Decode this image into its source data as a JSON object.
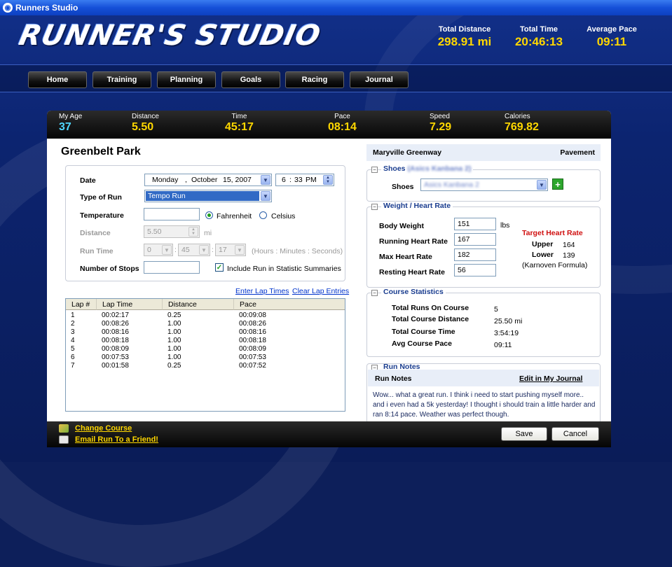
{
  "window": {
    "title": "Runners Studio"
  },
  "logo": "RUNNER'S STUDIO",
  "header_stats": [
    {
      "label": "Total Distance",
      "value": "298.91 mi"
    },
    {
      "label": "Total Time",
      "value": "20:46:13"
    },
    {
      "label": "Average Pace",
      "value": "09:11"
    }
  ],
  "nav": [
    "Home",
    "Training",
    "Planning",
    "Goals",
    "Racing",
    "Journal"
  ],
  "stats": [
    {
      "label": "My Age",
      "value": "37"
    },
    {
      "label": "Distance",
      "value": "5.50"
    },
    {
      "label": "Time",
      "value": "45:17"
    },
    {
      "label": "Pace",
      "value": "08:14"
    },
    {
      "label": "Speed",
      "value": "7.29"
    },
    {
      "label": "Calories",
      "value": "769.82"
    }
  ],
  "run": {
    "location": "Greenbelt Park",
    "date_label": "Date",
    "date_weekday": "Monday",
    "date_sep": ",",
    "date_month": "October",
    "date_day": "15, 2007",
    "time_hour": "6",
    "time_sep": ":",
    "time_min": "33",
    "time_ampm": "PM",
    "type_label": "Type of Run",
    "type_value": "Tempo Run",
    "temp_label": "Temperature",
    "temp_value": "",
    "fahrenheit": "Fahrenheit",
    "celsius": "Celsius",
    "distance_label": "Distance",
    "distance_value": "5.50",
    "distance_unit": "mi",
    "runtime_label": "Run Time",
    "rt_hours": "0",
    "rt_minutes": "45",
    "rt_seconds": "17",
    "rt_colon": ":",
    "rt_hint": "(Hours : Minutes : Seconds)",
    "stops_label": "Number of Stops",
    "stops_value": "",
    "include_label": "Include Run in Statistic Summaries",
    "include_check": "✓"
  },
  "laps": {
    "enter_link": "Enter Lap Times",
    "clear_link": "Clear Lap Entries",
    "headers": [
      "Lap #",
      "Lap Time",
      "Distance",
      "Pace"
    ],
    "rows": [
      [
        "1",
        "00:02:17",
        "0.25",
        "00:09:08"
      ],
      [
        "2",
        "00:08:26",
        "1.00",
        "00:08:26"
      ],
      [
        "3",
        "00:08:16",
        "1.00",
        "00:08:16"
      ],
      [
        "4",
        "00:08:18",
        "1.00",
        "00:08:18"
      ],
      [
        "5",
        "00:08:09",
        "1.00",
        "00:08:09"
      ],
      [
        "6",
        "00:07:53",
        "1.00",
        "00:07:53"
      ],
      [
        "7",
        "00:01:58",
        "0.25",
        "00:07:52"
      ]
    ]
  },
  "course": {
    "name": "Maryville Greenway",
    "surface": "Pavement"
  },
  "shoes": {
    "title": "Shoes",
    "title_detail": "(Asics Kanbana 2)",
    "label": "Shoes",
    "value": "Asics Kanbana 2",
    "add": "+"
  },
  "weight": {
    "title": "Weight / Heart Rate",
    "body_label": "Body Weight",
    "body_value": "151",
    "body_unit": "lbs",
    "running_label": "Running Heart Rate",
    "running_value": "167",
    "max_label": "Max Heart Rate",
    "max_value": "182",
    "resting_label": "Resting Heart Rate",
    "resting_value": "56",
    "target_title": "Target Heart Rate",
    "upper_label": "Upper",
    "upper_value": "164",
    "lower_label": "Lower",
    "lower_value": "139",
    "formula": "(Karnoven Formula)"
  },
  "course_stats": {
    "title": "Course Statistics",
    "rows": [
      {
        "label": "Total Runs On Course",
        "value": "5"
      },
      {
        "label": "Total Course Distance",
        "value": "25.50 mi"
      },
      {
        "label": "Total Course Time",
        "value": "3:54:19"
      },
      {
        "label": "Avg Course Pace",
        "value": "09:11"
      }
    ]
  },
  "notes": {
    "title": "Run Notes",
    "header": "Run Notes",
    "edit_link": "Edit in My Journal",
    "text": "Wow... what a great run. I think i need to start pushing myself more.. and i even had a 5k yesterday! I thought i should train a little harder and ran 8:14 pace. Weather was perfect though."
  },
  "footer": {
    "change_course": "Change Course",
    "email_run": "Email Run To a Friend!",
    "save": "Save",
    "cancel": "Cancel"
  },
  "icons": [
    "app-icon",
    "dropdown-arrow-icon",
    "spinner-icon",
    "add-icon",
    "collapse-icon",
    "map-icon",
    "mail-icon"
  ]
}
